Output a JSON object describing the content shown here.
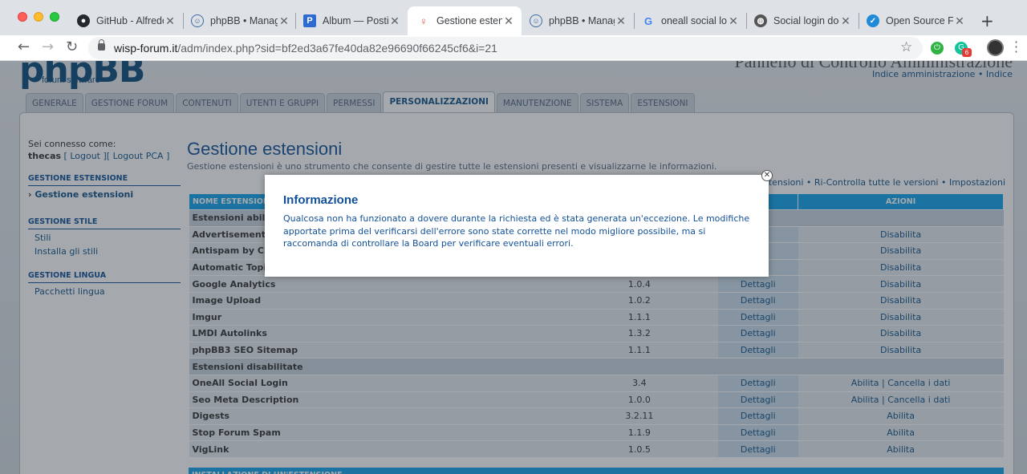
{
  "tabs": [
    {
      "title": "GitHub - Alfredo",
      "icon": "github-icon"
    },
    {
      "title": "phpBB • Manage",
      "icon": "phpbb-icon"
    },
    {
      "title": "Album — Posting",
      "icon": "postimage-icon"
    },
    {
      "title": "Gestione estens",
      "icon": "microphone-icon",
      "active": true
    },
    {
      "title": "phpBB • Manage",
      "icon": "phpbb-icon"
    },
    {
      "title": "oneall social log",
      "icon": "google-icon"
    },
    {
      "title": "Social login doe",
      "icon": "globe-icon"
    },
    {
      "title": "Open Source Fo",
      "icon": "open-source-icon"
    }
  ],
  "address": {
    "host": "wisp-forum.it",
    "path": "/adm/index.php?sid=bf2ed3a67fe40da82e96690f66245cf6&i=21"
  },
  "extensions": {
    "ext2_badge": "6"
  },
  "header": {
    "logo_main": "phpBB",
    "logo_sub": "forum software",
    "acp_title": "Pannello di Controllo Amministrazione",
    "links": "Indice amministrazione • Indice"
  },
  "nav_tabs": [
    "GENERALE",
    "GESTIONE FORUM",
    "CONTENUTI",
    "UTENTI E GRUPPI",
    "PERMESSI",
    "PERSONALIZZAZIONI",
    "MANUTENZIONE",
    "SISTEMA",
    "ESTENSIONI"
  ],
  "sidebar": {
    "login_label": "Sei connesso come:",
    "user": "thecas",
    "links": "[ Logout ][ Logout PCA ]",
    "sections": [
      {
        "title": "GESTIONE ESTENSIONE",
        "items": [
          {
            "label": "Gestione estensioni",
            "current": true
          }
        ]
      },
      {
        "title": "GESTIONE STILE",
        "items": [
          {
            "label": "Stili"
          },
          {
            "label": "Installa gli stili"
          }
        ]
      },
      {
        "title": "GESTIONE LINGUA",
        "items": [
          {
            "label": "Pacchetti lingua"
          }
        ]
      }
    ]
  },
  "main": {
    "title": "Gestione estensioni",
    "description": "Gestione estensioni è uno strumento che consente di gestire tutte le estensioni presenti e visualizzarne le informazioni.",
    "actions": "e estensioni • Ri-Controlla tutte le versioni • Impostazioni",
    "table": {
      "headers": [
        "NOME ESTENSIONE",
        "",
        "",
        "AZIONI"
      ],
      "enabled_section": "Estensioni abilita",
      "enabled": [
        {
          "name": "Advertisement M",
          "version": "",
          "details": "",
          "action": "Disabilita"
        },
        {
          "name": "Antispam by Clea",
          "version": "",
          "details": "",
          "action": "Disabilita"
        },
        {
          "name": "Automatic Topic",
          "version": "",
          "details": "",
          "action": "Disabilita"
        },
        {
          "name": "Google Analytics",
          "version": "1.0.4",
          "details": "Dettagli",
          "action": "Disabilita"
        },
        {
          "name": "Image Upload",
          "version": "1.0.2",
          "details": "Dettagli",
          "action": "Disabilita"
        },
        {
          "name": "Imgur",
          "version": "1.1.1",
          "details": "Dettagli",
          "action": "Disabilita"
        },
        {
          "name": "LMDI Autolinks",
          "version": "1.3.2",
          "details": "Dettagli",
          "action": "Disabilita"
        },
        {
          "name": "phpBB3 SEO Sitemap",
          "version": "1.1.1",
          "details": "Dettagli",
          "action": "Disabilita"
        }
      ],
      "disabled_section": "Estensioni disabilitate",
      "disabled": [
        {
          "name": "OneAll Social Login",
          "version": "3.4",
          "details": "Dettagli",
          "action": "Abilita |  Cancella i dati"
        },
        {
          "name": "Seo Meta Description",
          "version": "1.0.0",
          "details": "Dettagli",
          "action": "Abilita |  Cancella i dati"
        },
        {
          "name": "Digests",
          "version": "3.2.11",
          "details": "Dettagli",
          "action": "Abilita"
        },
        {
          "name": "Stop Forum Spam",
          "version": "1.1.9",
          "details": "Dettagli",
          "action": "Abilita"
        },
        {
          "name": "VigLink",
          "version": "1.0.5",
          "details": "Dettagli",
          "action": "Abilita"
        }
      ],
      "install_header": "INSTALLAZIONE DI UN'ESTENSIONE"
    }
  },
  "modal": {
    "title": "Informazione",
    "body": "Qualcosa non ha funzionato a dovere durante la richiesta ed è stata generata un'eccezione. Le modifiche apportate prima del verificarsi dell'errore sono state corrette nel modo migliore possibile, ma si raccomanda di controllare la Board per verificare eventuali errori."
  }
}
